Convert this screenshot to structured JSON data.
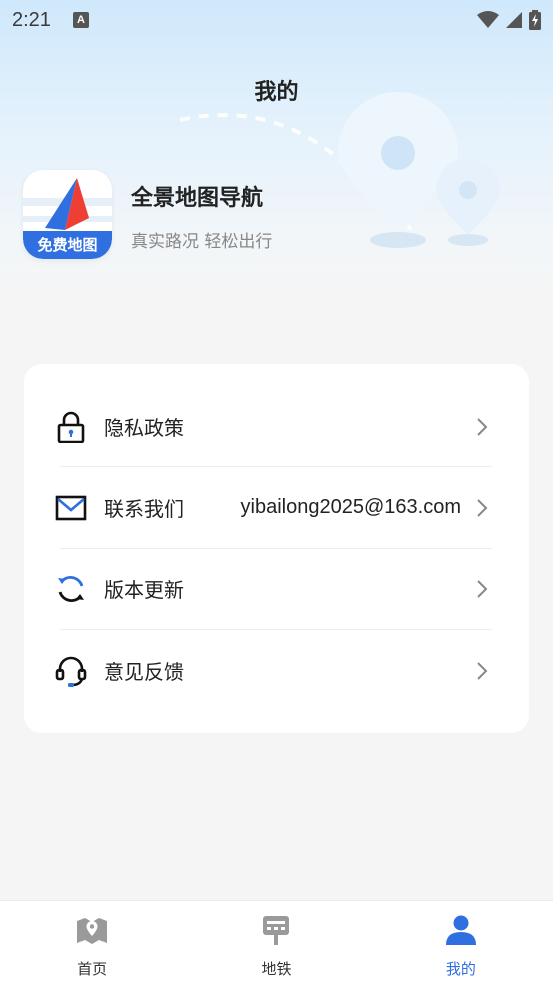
{
  "status_bar": {
    "time": "2:21",
    "indicator": "A",
    "icons": [
      "wifi-icon",
      "signal-icon",
      "battery-charging-icon"
    ]
  },
  "page": {
    "title": "我的"
  },
  "app": {
    "name": "全景地图导航",
    "slogan": "真实路况 轻松出行",
    "icon_badge": "免费地图"
  },
  "menu": {
    "items": [
      {
        "label": "隐私政策",
        "value": "",
        "icon": "lock-icon"
      },
      {
        "label": "联系我们",
        "value": "yibailong2025@163.com",
        "icon": "mail-icon"
      },
      {
        "label": "版本更新",
        "value": "",
        "icon": "refresh-icon"
      },
      {
        "label": "意见反馈",
        "value": "",
        "icon": "headset-icon"
      }
    ]
  },
  "bottom_nav": {
    "items": [
      {
        "label": "首页",
        "icon": "map-icon",
        "active": false
      },
      {
        "label": "地铁",
        "icon": "subway-icon",
        "active": false
      },
      {
        "label": "我的",
        "icon": "user-icon",
        "active": true
      }
    ]
  },
  "colors": {
    "accent": "#2f6fe0",
    "page_bg": "#f5f5f5",
    "hero_top": "#cfe8fb",
    "icon_gray": "#9a9a9a"
  }
}
